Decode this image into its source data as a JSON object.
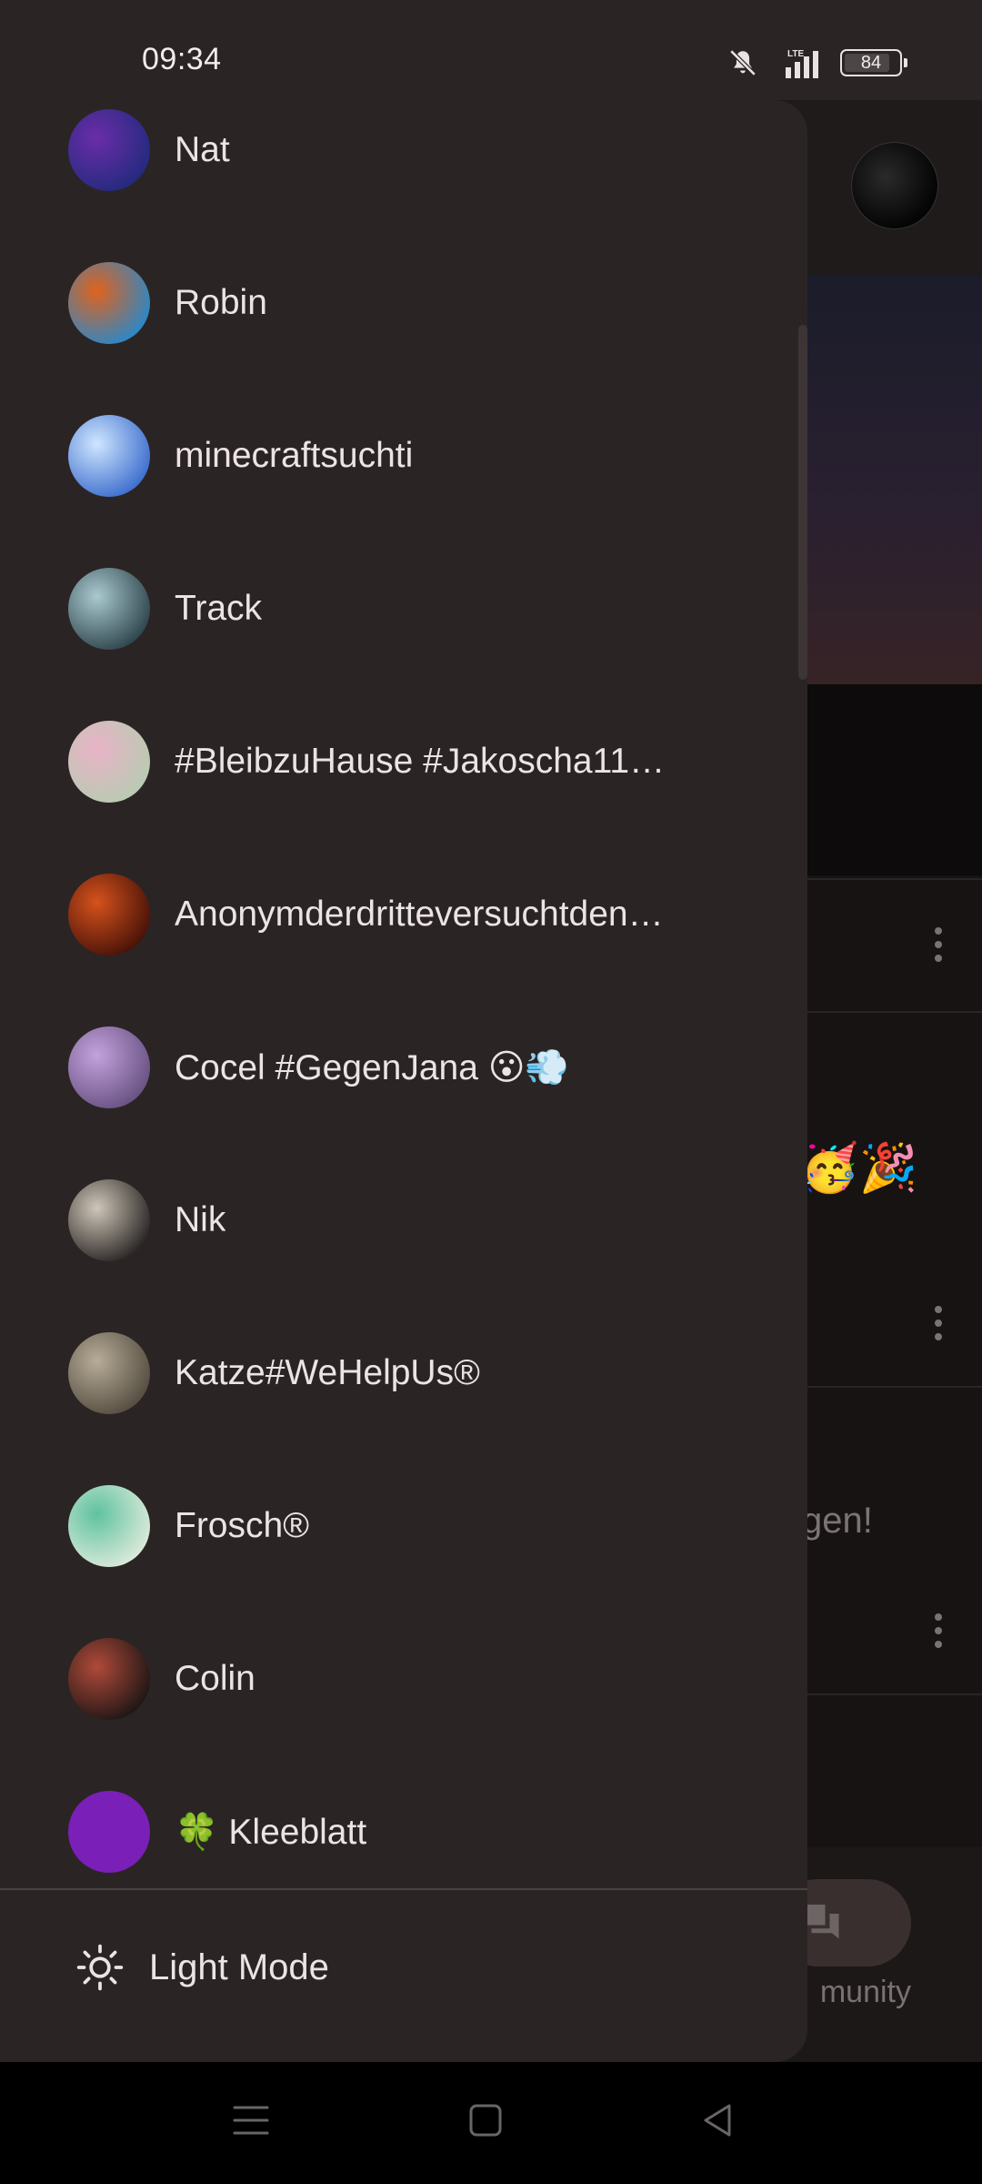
{
  "status_bar": {
    "time": "09:34",
    "network": "LTE",
    "battery": "84",
    "battery_level": 0.84,
    "icons": [
      "bell-off-icon",
      "signal-icon",
      "battery-icon"
    ]
  },
  "drawer": {
    "items": [
      {
        "name": "Nat",
        "avatar_colors": [
          "#6b2da8",
          "#1c2a7a"
        ]
      },
      {
        "name": "Robin",
        "avatar_colors": [
          "#e0621c",
          "#1a8bd8"
        ]
      },
      {
        "name": "minecraftsuchti",
        "avatar_colors": [
          "#cfe6ff",
          "#2f63c9"
        ]
      },
      {
        "name": "Track",
        "avatar_colors": [
          "#a9c9cf",
          "#233840"
        ]
      },
      {
        "name": "#BleibzuHause #Jakoscha11…",
        "avatar_colors": [
          "#e9b3c7",
          "#b4cdb0"
        ]
      },
      {
        "name": "Anonymderdritteversuchtden…",
        "avatar_colors": [
          "#d5521c",
          "#3b0c06"
        ]
      },
      {
        "name": "Cocel #GegenJana 😮💨",
        "avatar_colors": [
          "#c4a2dc",
          "#5f4a7a"
        ]
      },
      {
        "name": "Nik",
        "avatar_colors": [
          "#cfc6b8",
          "#1a1717"
        ]
      },
      {
        "name": "Katze#WeHelpUs®",
        "avatar_colors": [
          "#b8ac98",
          "#4b4438"
        ]
      },
      {
        "name": "Frosch®",
        "avatar_colors": [
          "#5fc2a0",
          "#e8eee0"
        ]
      },
      {
        "name": "Colin",
        "avatar_colors": [
          "#b04a3a",
          "#111111"
        ]
      },
      {
        "name": "🍀 Kleeblatt",
        "avatar_colors": [
          "#7a1fb8",
          "#7a1fb8"
        ]
      }
    ],
    "footer": {
      "label": "Light Mode",
      "icon": "sun-icon"
    }
  },
  "background": {
    "partial_text": "gen!",
    "partial_emoji": "🥳🎉",
    "community_label": "munity"
  },
  "system_nav": {
    "icons": [
      "menu-icon",
      "home-icon",
      "back-icon"
    ]
  }
}
